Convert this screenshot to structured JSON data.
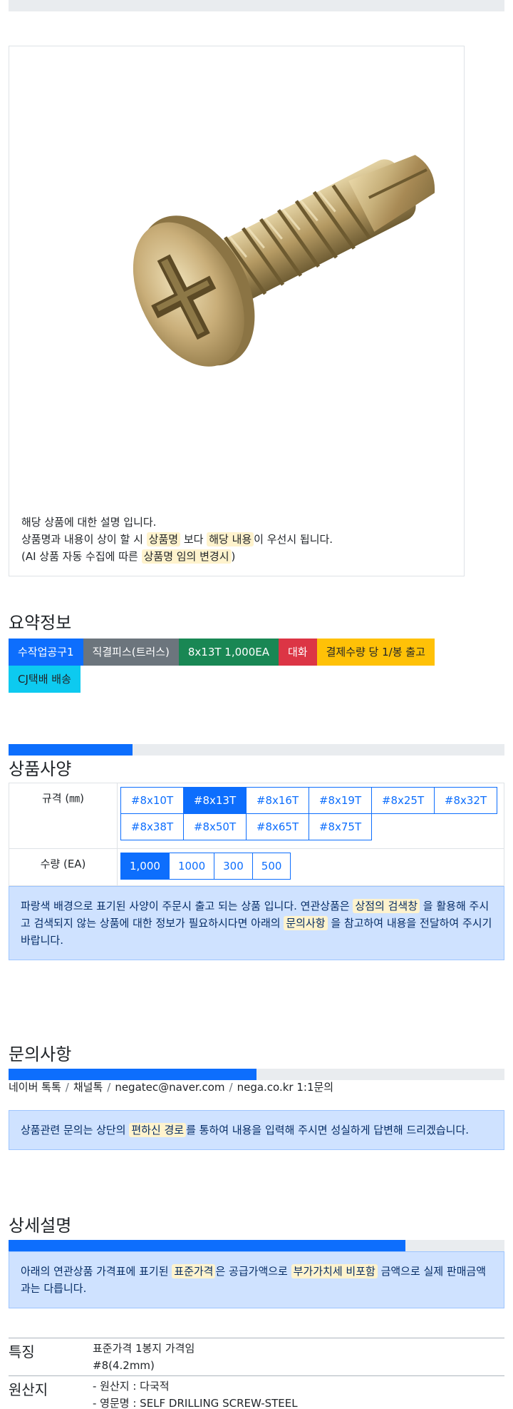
{
  "product_image": {
    "notes": {
      "line1": "해당 상품에 대한 설명 입니다.",
      "line2_a": "상품명과 내용이 상이 할 시 ",
      "line2_hl1": "상품명",
      "line2_b": " 보다 ",
      "line2_hl2": "해당 내용",
      "line2_c": "이 우선시 됩니다.",
      "line3_a": "(AI 상품 자동 수집에 따른 ",
      "line3_hl": "상품명 임의 변경시",
      "line3_b": ")"
    }
  },
  "summary": {
    "title": "요약정보",
    "badges": [
      "수작업공구1",
      "직결피스(트러스)",
      "8x13T 1,000EA",
      "대화",
      "결제수량 당 1/봉 출고",
      "CJ택배 배송"
    ]
  },
  "specs": {
    "title": "상품사양",
    "progress_fraction": 0.25,
    "size_label": "규격 (㎜)",
    "size_options": [
      "#8x10T",
      "#8x13T",
      "#8x16T",
      "#8x19T",
      "#8x25T",
      "#8x32T",
      "#8x38T",
      "#8x50T",
      "#8x65T",
      "#8x75T"
    ],
    "size_selected": "#8x13T",
    "qty_label": "수량 (EA)",
    "qty_options": [
      "1,000",
      "1000",
      "300",
      "500"
    ],
    "qty_selected": "1,000",
    "notice": {
      "a": "파랑색 배경으로 표기된 사양이 주문시 출고 되는 상품 입니다. 연관상품은 ",
      "hl1": "상점의 검색창",
      "b": " 을 활용해 주시고 검색되지 않는 상품에 대한 정보가 필요하시다면 아래의 ",
      "hl2": "문의사항",
      "c": " 을 참고하여 내용을 전달하여 주시기 바랍니다."
    }
  },
  "inquiry": {
    "title": "문의사항",
    "progress_fraction": 0.5,
    "channels": [
      "네이버 톡톡",
      "채널톡",
      "negatec@naver.com",
      "nega.co.kr 1:1문의"
    ],
    "separator": "/",
    "notice": {
      "a": "상품관련 문의는 상단의 ",
      "hl": "편하신 경로",
      "b": "를 통하여 내용을 입력해 주시면 성실하게 답변해 드리겠습니다."
    }
  },
  "details": {
    "title": "상세설명",
    "progress_fraction": 0.8,
    "notice": {
      "a": "아래의 연관상품 가격표에 표기된 ",
      "hl1": "표준가격",
      "b": "은 공급가액으로 ",
      "hl2": "부가가치세 비포함",
      "c": " 금액으로 실제 판매금액과는 다릅니다."
    },
    "rows": [
      {
        "head": "특징",
        "values": [
          "표준가격 1봉지 가격임",
          "#8(4.2mm)"
        ]
      },
      {
        "head": "원산지",
        "values": [
          "- 원산지 : 다국적",
          "- 영문명 : SELF DRILLING SCREW-STEEL"
        ]
      }
    ]
  },
  "colors": {
    "primary": "#0d6efd",
    "secondary": "#6c757d",
    "success": "#198754",
    "danger": "#dc3545",
    "warning": "#ffc107",
    "info": "#0dcaf0",
    "highlight": "#fff3cd",
    "alert_bg": "#cfe2ff"
  }
}
